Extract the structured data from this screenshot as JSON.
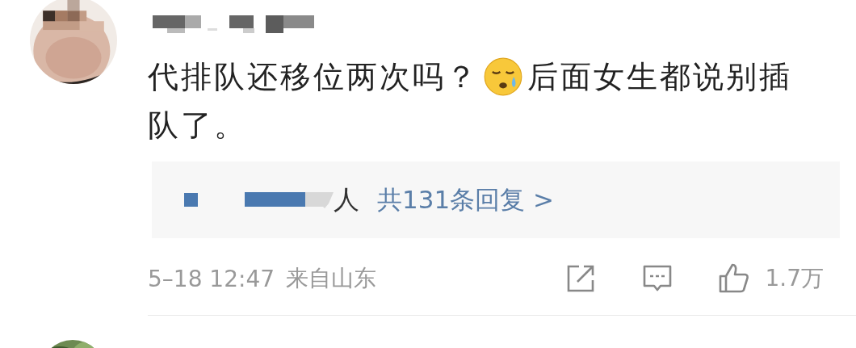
{
  "comment": {
    "text_before_emoji": "代排队还移位两次吗？",
    "text_after_emoji": "后面女生都说别插",
    "text_continued": "队了。",
    "reply_preview": {
      "suffix": "人",
      "link": "共131条回复 >"
    },
    "time": "5–18 12:47",
    "location": "来自山东",
    "like_count": "1.7万"
  }
}
